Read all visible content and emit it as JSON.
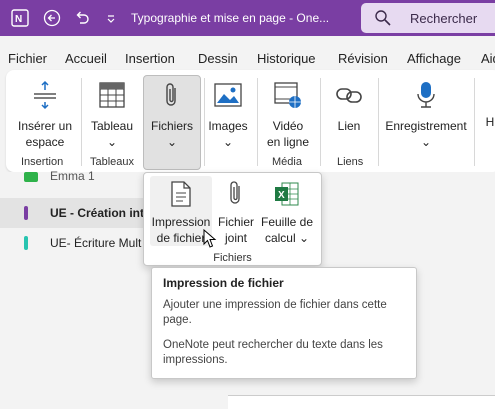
{
  "titlebar": {
    "title": "Typographie et mise en page  -  One...",
    "search_label": "Rechercher",
    "icons": [
      "onenote-logo-icon",
      "back-arrow-icon",
      "undo-icon",
      "customize-qat-icon",
      "search-icon"
    ]
  },
  "menu": {
    "items": [
      "Fichier",
      "Accueil",
      "Insertion",
      "Dessin",
      "Historique",
      "Révision",
      "Affichage",
      "Aid"
    ],
    "active": "Insertion"
  },
  "ribbon": {
    "insert_space": {
      "line1": "Insérer un",
      "line2": "espace"
    },
    "table": {
      "label": "Tableau"
    },
    "files": {
      "label": "Fichiers"
    },
    "images": {
      "label": "Images"
    },
    "video": {
      "line1": "Vidéo",
      "line2": "en ligne"
    },
    "link": {
      "label": "Lien"
    },
    "recording": {
      "label": "Enregistrement"
    },
    "cut_off": "H",
    "groups": {
      "insertion": "Insertion",
      "tableaux": "Tableaux",
      "media": "Média",
      "liens": "Liens"
    },
    "chevron": "⌄"
  },
  "sections": [
    {
      "text": "Emma 1",
      "color": "#2fb24a"
    },
    {
      "text": "UE - Création int",
      "color": "#7a3ea3",
      "selected": true
    },
    {
      "text": "UE- Écriture Mult",
      "color": "#27c4b0"
    }
  ],
  "dropdown": {
    "print": {
      "line1": "Impression",
      "line2": "de fichier"
    },
    "attach": {
      "line1": "Fichier",
      "line2": "joint"
    },
    "sheet": {
      "line1": "Feuille de",
      "line2": "calcul"
    },
    "group_label": "Fichiers"
  },
  "tooltip": {
    "title": "Impression de fichier",
    "text1": "Ajouter une impression de fichier dans cette page.",
    "text2": "OneNote peut rechercher du texte dans les impressions."
  }
}
